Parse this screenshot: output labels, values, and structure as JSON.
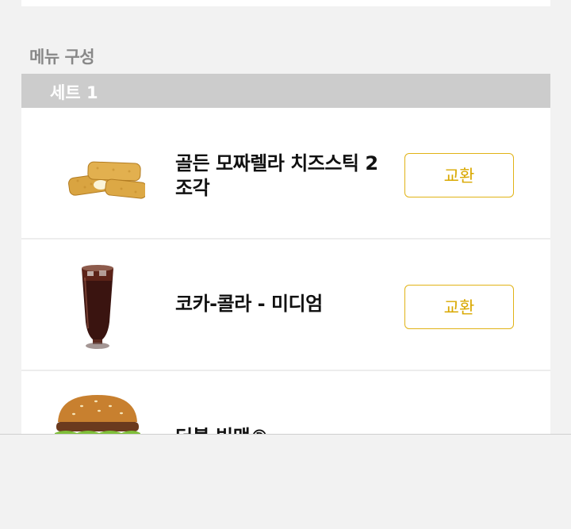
{
  "section": {
    "title": "메뉴 구성"
  },
  "set": {
    "label": "세트 1"
  },
  "items": [
    {
      "name": "골든 모짜렐라 치즈스틱 2조각",
      "image_icon": "cheese-sticks-image",
      "swap_label": "교환"
    },
    {
      "name": "코카-콜라 - 미디엄",
      "image_icon": "cola-cup-image",
      "swap_label": "교환"
    },
    {
      "name": "더블 빅맥®",
      "image_icon": "burger-image"
    }
  ],
  "colors": {
    "accent": "#d9a800",
    "set_header_bg": "#cccccc",
    "page_bg": "#f2f2f2"
  }
}
